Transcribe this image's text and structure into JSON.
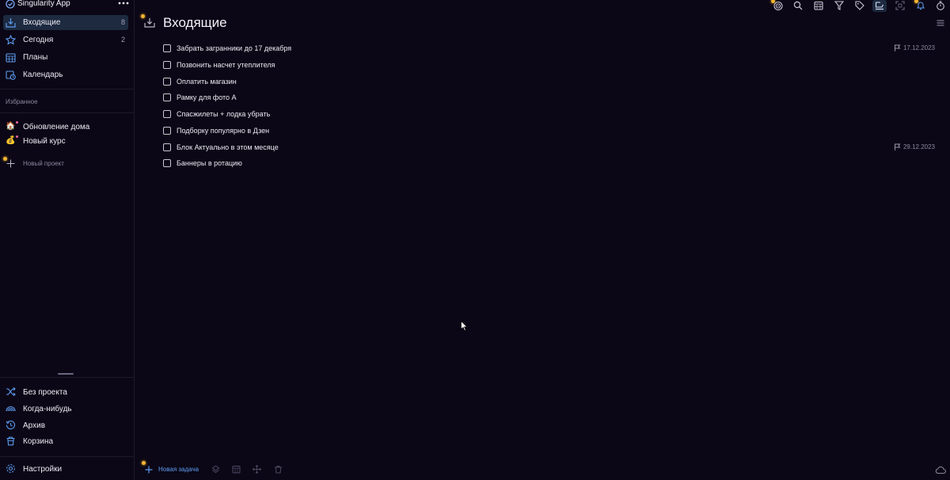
{
  "app": {
    "title": "Singularity App"
  },
  "sidebar": {
    "nav": [
      {
        "id": "inbox",
        "label": "Входящие",
        "count": "8",
        "icon": "inbox-icon",
        "active": true
      },
      {
        "id": "today",
        "label": "Сегодня",
        "count": "2",
        "icon": "star-icon",
        "active": false
      },
      {
        "id": "plans",
        "label": "Планы",
        "count": "",
        "icon": "calendar-grid-icon",
        "active": false
      },
      {
        "id": "calendar",
        "label": "Календарь",
        "count": "",
        "icon": "calendar-clock-icon",
        "active": false
      }
    ],
    "favorites_label": "Избранное",
    "favorites": [
      {
        "label": "Обновление дома",
        "emoji": "🏠"
      },
      {
        "label": "Новый курс",
        "emoji": "💰"
      }
    ],
    "new_project_label": "Новый проект",
    "bottom": [
      {
        "label": "Без проекта",
        "icon": "shuffle-icon"
      },
      {
        "label": "Когда-нибудь",
        "icon": "rainbow-icon"
      },
      {
        "label": "Архив",
        "icon": "history-icon"
      },
      {
        "label": "Корзина",
        "icon": "trash-icon"
      }
    ],
    "settings_label": "Настройки"
  },
  "main": {
    "title": "Входящие",
    "tasks": [
      {
        "title": "Забрать загранники до 17 декабря",
        "due": "17.12.2023"
      },
      {
        "title": "Позвонить насчет утеплителя",
        "due": ""
      },
      {
        "title": "Оплатить магазин",
        "due": ""
      },
      {
        "title": "Рамку для фото А",
        "due": ""
      },
      {
        "title": "Спасжилеты + лодка убрать",
        "due": ""
      },
      {
        "title": "Подборку популярно в Дзен",
        "due": ""
      },
      {
        "title": "Блок Актуально в этом месяце",
        "due": "29.12.2023"
      },
      {
        "title": "Баннеры в ротацию",
        "due": ""
      }
    ],
    "new_task_label": "Новая задача"
  },
  "colors": {
    "background": "#0b0716",
    "accent_blue": "#5d9cf0",
    "active_bg": "#1d2a40",
    "highlight_yellow": "#f3b530"
  },
  "toolbar": {
    "icons": [
      "focus-timer-icon",
      "search-icon",
      "calendar-icon",
      "filter-icon",
      "tag-icon",
      "view-mode-icon",
      "fullscreen-icon",
      "bell-icon",
      "stopwatch-icon"
    ],
    "active": "view-mode-icon"
  }
}
